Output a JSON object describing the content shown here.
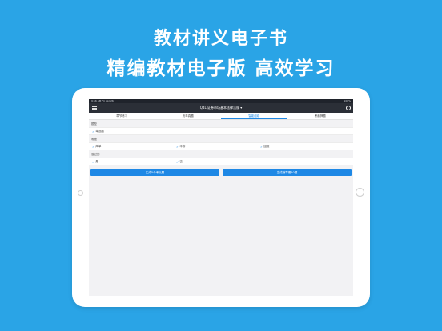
{
  "headline": {
    "line1": "教材讲义电子书",
    "line2": "精编教材电子版  高效学习"
  },
  "status": {
    "left": "9:56 AM  Fri Apr 26",
    "right": "100%"
  },
  "nav": {
    "title": "Q4L 证券市场基本法律法规 ▾"
  },
  "tabs": [
    {
      "label": "章节练习"
    },
    {
      "label": "历年真题"
    },
    {
      "label": "智能组卷"
    },
    {
      "label": "考前押题"
    }
  ],
  "sections": {
    "type": {
      "label": "题型",
      "options": [
        "单选题"
      ]
    },
    "difficulty": {
      "label": "难度",
      "options": [
        "简单",
        "中等",
        "困难"
      ]
    },
    "done": {
      "label": "做过的",
      "options": [
        "是",
        "否"
      ]
    }
  },
  "buttons": {
    "left": "生成5个考点题",
    "right": "生成随章看50题"
  }
}
